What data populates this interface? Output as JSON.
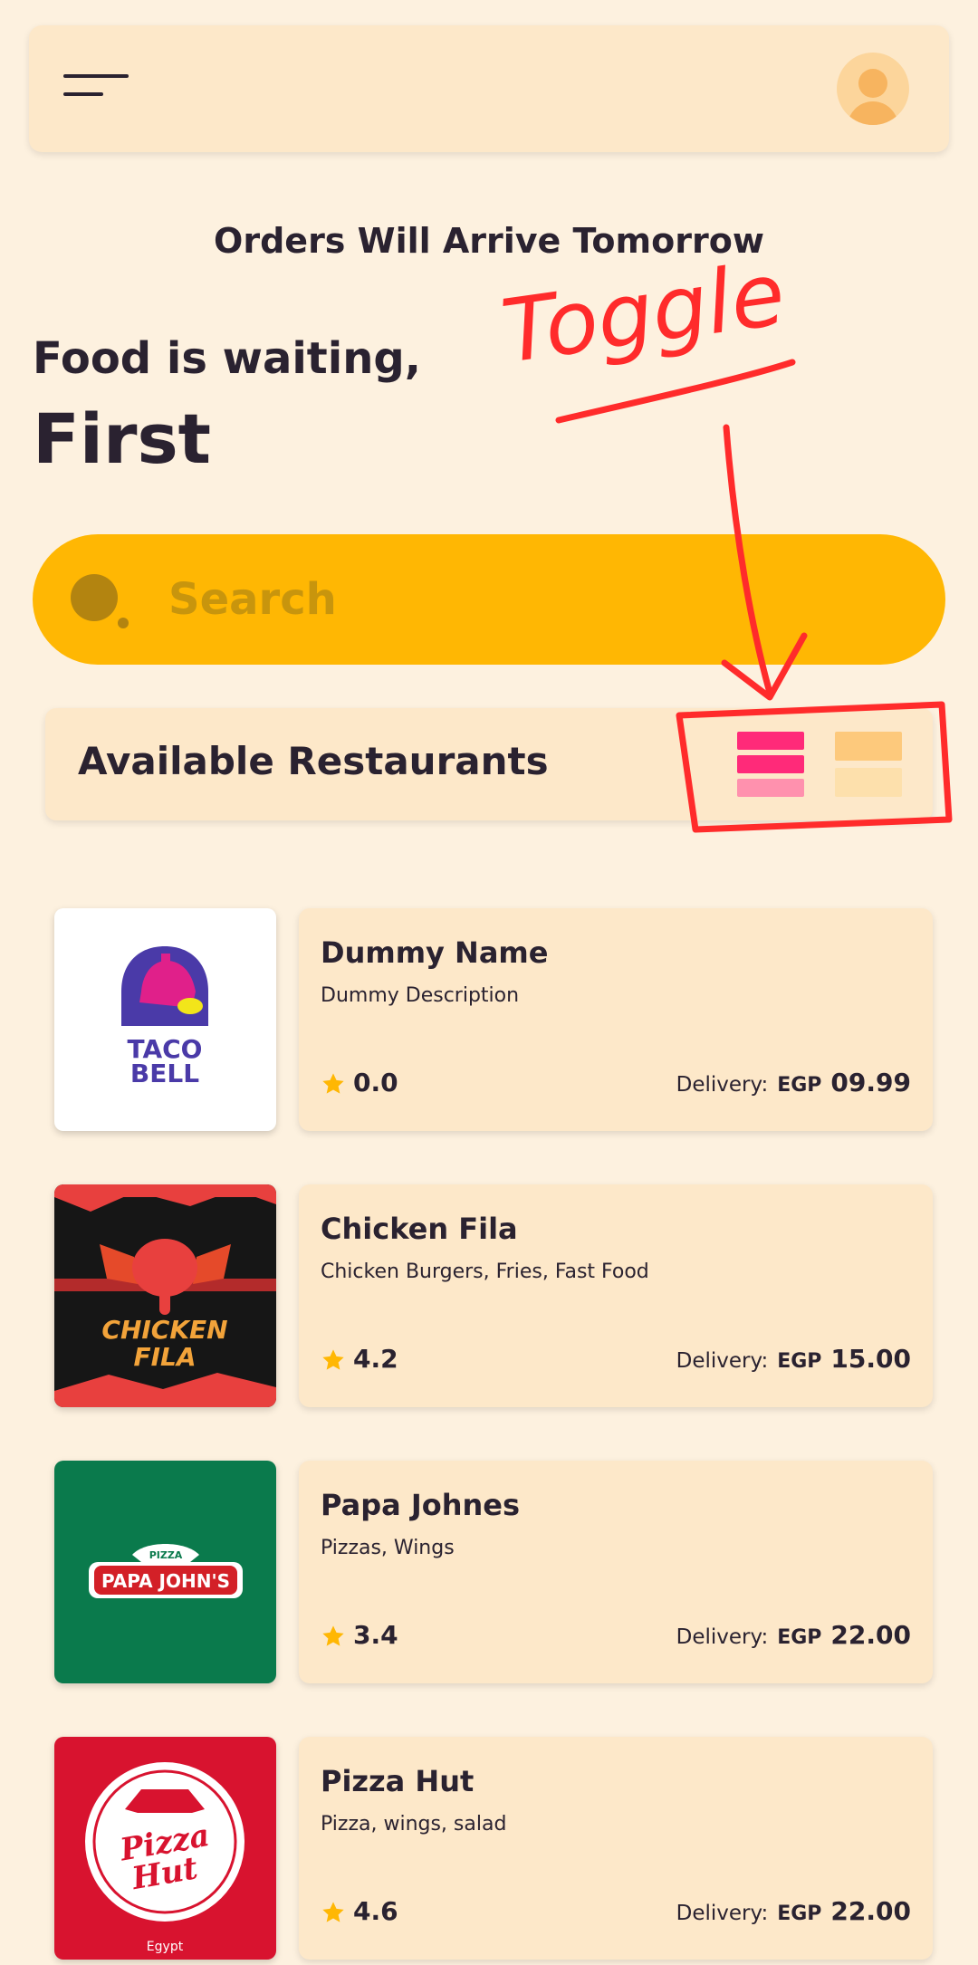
{
  "header": {
    "menu_icon": "hamburger-menu-icon",
    "avatar_icon": "user-avatar-icon"
  },
  "notice": "Orders Will Arrive Tomorrow",
  "greeting": {
    "line1": "Food is waiting,",
    "name": "First"
  },
  "search": {
    "placeholder": "Search",
    "icon": "search-icon"
  },
  "section": {
    "title": "Available Restaurants",
    "view_toggle": {
      "active": "list",
      "options": [
        "list",
        "grid"
      ]
    }
  },
  "annotation": {
    "text": "Toggle",
    "color": "#ff2b2b"
  },
  "currency": "EGP",
  "delivery_label": "Delivery:",
  "restaurants": [
    {
      "name": "Dummy Name",
      "description": "Dummy Description",
      "rating": "0.0",
      "delivery_fee": "09.99",
      "logo": "taco-bell-logo",
      "logo_text": [
        "TACO",
        "BELL"
      ]
    },
    {
      "name": "Chicken Fila",
      "description": "Chicken Burgers, Fries, Fast Food",
      "rating": "4.2",
      "delivery_fee": "15.00",
      "logo": "chicken-fila-logo",
      "logo_text": [
        "CHICKEN",
        "FILA"
      ]
    },
    {
      "name": "Papa Johnes",
      "description": "Pizzas, Wings",
      "rating": "3.4",
      "delivery_fee": "22.00",
      "logo": "papa-johns-logo",
      "logo_text": [
        "PIZZA",
        "PAPA JOHN'S"
      ]
    },
    {
      "name": "Pizza Hut",
      "description": "Pizza, wings, salad",
      "rating": "4.6",
      "delivery_fee": "22.00",
      "logo": "pizza-hut-logo",
      "logo_text": [
        "Pizza",
        "Hut",
        "Egypt"
      ]
    }
  ],
  "colors": {
    "background": "#fdf1df",
    "card": "#fde8c9",
    "accent": "#ffb703",
    "toggle_active": "#ff2a79",
    "toggle_inactive": "#fdc97c",
    "star": "#ffb703"
  }
}
